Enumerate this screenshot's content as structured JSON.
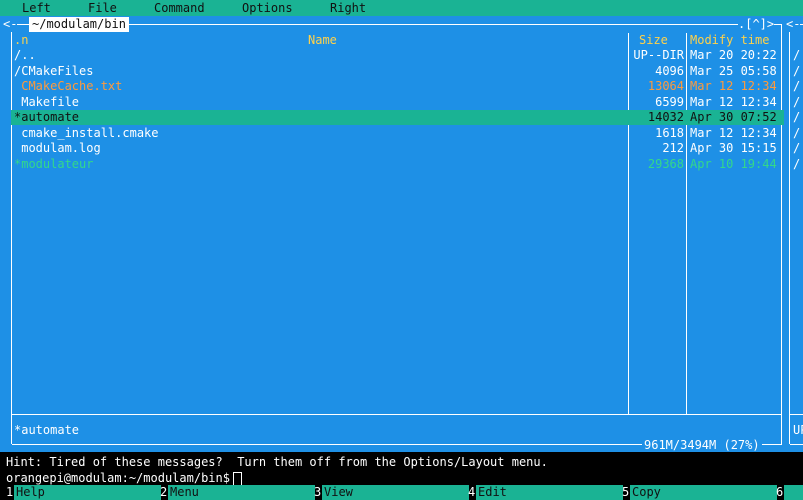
{
  "menu": [
    "Left",
    "File",
    "Command",
    "Options",
    "Right"
  ],
  "panel": {
    "path": "~/modulam/bin",
    "corner_left": "<-",
    "corner_right": ".[^]>",
    "headers": {
      "n": ".n",
      "name": "Name",
      "size": "Size",
      "mtime": "Modify time"
    },
    "rows": [
      {
        "name": "/..",
        "size": "UP--DIR",
        "date": "Mar 20 20:22",
        "color": "#ffffff"
      },
      {
        "name": "/CMakeFiles",
        "size": "4096",
        "date": "Mar 25 05:58",
        "color": "#ffffff"
      },
      {
        "name": " CMakeCache.txt",
        "size": "13064",
        "date": "Mar 12 12:34",
        "color": "#ff9a3c"
      },
      {
        "name": " Makefile",
        "size": "6599",
        "date": "Mar 12 12:34",
        "color": "#ffffff"
      },
      {
        "name": "*automate",
        "size": "14032",
        "date": "Apr 30 07:52",
        "color": "#111111",
        "selected": true
      },
      {
        "name": " cmake_install.cmake",
        "size": "1618",
        "date": "Mar 12 12:34",
        "color": "#ffffff"
      },
      {
        "name": " modulam.log",
        "size": "212",
        "date": "Apr 30 15:15",
        "color": "#ffffff"
      },
      {
        "name": "*modulateur",
        "size": "29368",
        "date": "Apr 10 19:44",
        "color": "#33d88a"
      }
    ],
    "status_file": "*automate",
    "disk_usage": "961M/3494M (27%)"
  },
  "right_panel": {
    "corner": "<-",
    "rows": [
      "/",
      "/",
      "/",
      "/",
      "/",
      "/",
      "/",
      "/"
    ],
    "status": "UP"
  },
  "hint": "Hint: Tired of these messages?  Turn them off from the Options/Layout menu.",
  "prompt": "orangepi@modulam:~/modulam/bin$",
  "fkeys": [
    {
      "num": "1",
      "label": "Help"
    },
    {
      "num": "2",
      "label": "Menu"
    },
    {
      "num": "3",
      "label": "View"
    },
    {
      "num": "4",
      "label": "Edit"
    },
    {
      "num": "5",
      "label": "Copy"
    },
    {
      "num": "6",
      "label": ""
    }
  ],
  "colors": {
    "panel_bg": "#1e90e6",
    "accent": "#1ab394",
    "header": "#ffd24a"
  }
}
